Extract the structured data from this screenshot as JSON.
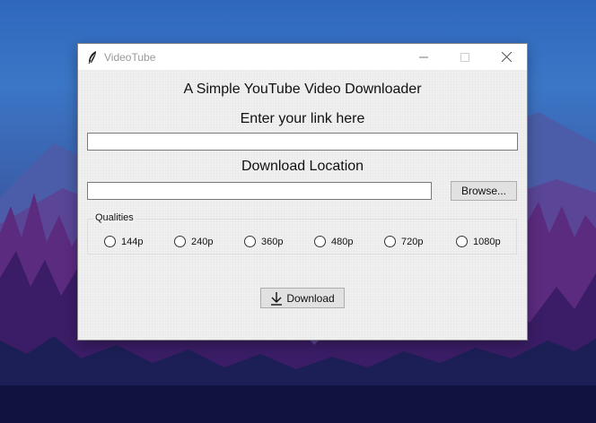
{
  "window": {
    "title": "VideoTube",
    "icon": "feather-icon",
    "controls": [
      "minimize-icon",
      "maximize-icon",
      "close-icon"
    ]
  },
  "main": {
    "app_heading": "A Simple YouTube Video Downloader",
    "link_label": "Enter your link here",
    "link_value": "",
    "location_label": "Download Location",
    "location_value": "",
    "browse_label": "Browse...",
    "qualities_label": "Qualities",
    "qualities": [
      "144p",
      "240p",
      "360p",
      "480p",
      "720p",
      "1080p"
    ],
    "download_label": "Download",
    "download_icon": "download-arrow-icon"
  },
  "colors": {
    "window_bg": "#f0f0f0",
    "titlebar_bg": "#ffffff",
    "button_bg": "#e1e1e1"
  }
}
